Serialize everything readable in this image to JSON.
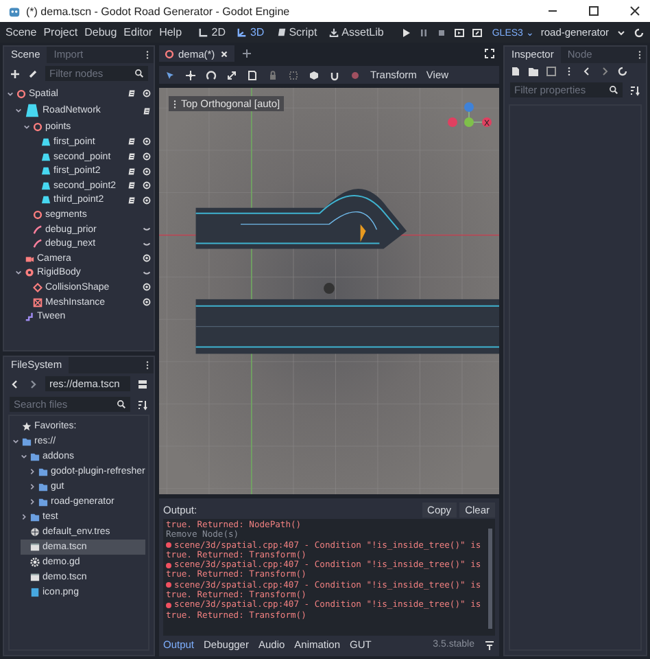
{
  "window": {
    "title": "(*) dema.tscn - Godot Road Generator - Godot Engine"
  },
  "menu": [
    "Scene",
    "Project",
    "Debug",
    "Editor",
    "Help"
  ],
  "workspaces": [
    {
      "label": "2D",
      "kind": "flat",
      "selected": false
    },
    {
      "label": "3D",
      "kind": "spatial",
      "selected": true
    },
    {
      "label": "Script",
      "kind": "script",
      "selected": false
    },
    {
      "label": "AssetLib",
      "kind": "assetlib",
      "selected": false
    }
  ],
  "renderer": "GLES3 ⌄",
  "project": "road-generator",
  "scene_dock": {
    "tabs": [
      {
        "label": "Scene",
        "selected": true
      },
      {
        "label": "Import",
        "selected": false
      }
    ],
    "filter": {
      "placeholder": "Filter nodes"
    },
    "tree": [
      {
        "name": "Spatial",
        "kind": "spatial",
        "script": true,
        "visible": true,
        "expanded": true,
        "children": [
          {
            "name": "RoadNetwork",
            "kind": "road",
            "script": true,
            "expanded": true,
            "children": [
              {
                "name": "points",
                "kind": "spatial",
                "expanded": true,
                "children": [
                  {
                    "name": "first_point",
                    "kind": "point",
                    "script": true,
                    "visible": true
                  },
                  {
                    "name": "second_point",
                    "kind": "point",
                    "script": true,
                    "visible": true
                  },
                  {
                    "name": "first_point2",
                    "kind": "point",
                    "script": true,
                    "visible": true
                  },
                  {
                    "name": "second_point2",
                    "kind": "point",
                    "script": true,
                    "visible": true
                  },
                  {
                    "name": "third_point2",
                    "kind": "point",
                    "script": true,
                    "visible": true
                  }
                ]
              },
              {
                "name": "segments",
                "kind": "spatial"
              },
              {
                "name": "debug_prior",
                "kind": "path",
                "visible": false
              },
              {
                "name": "debug_next",
                "kind": "path",
                "visible": false
              }
            ]
          },
          {
            "name": "Camera",
            "kind": "camera",
            "visible": true
          },
          {
            "name": "RigidBody",
            "kind": "body",
            "visible": false,
            "expanded": true,
            "children": [
              {
                "name": "CollisionShape",
                "kind": "collision",
                "visible": true
              },
              {
                "name": "MeshInstance",
                "kind": "mesh",
                "visible": true
              }
            ]
          },
          {
            "name": "Tween",
            "kind": "tween"
          }
        ]
      }
    ]
  },
  "filesystem": {
    "title": "FileSystem",
    "path": "res://dema.tscn",
    "search": {
      "placeholder": "Search files"
    },
    "tree": [
      {
        "name": "Favorites:",
        "kind": "favorites",
        "selected": false
      },
      {
        "name": "res://",
        "kind": "folder",
        "expanded": true,
        "selected": false,
        "children": [
          {
            "name": "addons",
            "kind": "folder",
            "expanded": true,
            "selected": false,
            "children": [
              {
                "name": "godot-plugin-refresher",
                "kind": "folder",
                "expanded": false,
                "selected": false
              },
              {
                "name": "gut",
                "kind": "folder",
                "expanded": false,
                "selected": false
              },
              {
                "name": "road-generator",
                "kind": "folder",
                "expanded": false,
                "selected": false
              }
            ]
          },
          {
            "name": "test",
            "kind": "folder",
            "expanded": false,
            "selected": false
          },
          {
            "name": "default_env.tres",
            "kind": "env",
            "selected": false
          },
          {
            "name": "dema.tscn",
            "kind": "scene",
            "selected": true
          },
          {
            "name": "demo.gd",
            "kind": "gd",
            "selected": false
          },
          {
            "name": "demo.tscn",
            "kind": "scene",
            "selected": false
          },
          {
            "name": "icon.png",
            "kind": "image",
            "selected": false
          }
        ]
      }
    ]
  },
  "editor_tabs": [
    {
      "label": "dema(*)",
      "selected": true
    }
  ],
  "toolbar": [
    "Transform",
    "View"
  ],
  "viewport": {
    "label": "Top Orthogonal [auto]",
    "gizmo_axis": "X"
  },
  "output": {
    "title": "Output:",
    "buttons": [
      "Copy",
      "Clear"
    ],
    "lines": [
      {
        "kind": "error",
        "text": "true. Returned: NodePath()"
      },
      {
        "kind": "info",
        "text": "Remove Node(s)"
      },
      {
        "kind": "error-head",
        "text": "scene/3d/spatial.cpp:407 - Condition \"!is_inside_tree()\" is"
      },
      {
        "kind": "error",
        "text": "true. Returned: Transform()"
      },
      {
        "kind": "error-head",
        "text": "scene/3d/spatial.cpp:407 - Condition \"!is_inside_tree()\" is"
      },
      {
        "kind": "error",
        "text": "true. Returned: Transform()"
      },
      {
        "kind": "error-head",
        "text": "scene/3d/spatial.cpp:407 - Condition \"!is_inside_tree()\" is"
      },
      {
        "kind": "error",
        "text": "true. Returned: Transform()"
      },
      {
        "kind": "error-head",
        "text": "scene/3d/spatial.cpp:407 - Condition \"!is_inside_tree()\" is"
      },
      {
        "kind": "error",
        "text": "true. Returned: Transform()"
      }
    ]
  },
  "bottom_tabs": [
    {
      "label": "Output",
      "selected": true
    },
    {
      "label": "Debugger",
      "selected": false
    },
    {
      "label": "Audio",
      "selected": false
    },
    {
      "label": "Animation",
      "selected": false
    },
    {
      "label": "GUT",
      "selected": false
    }
  ],
  "version": "3.5.stable",
  "inspector": {
    "tabs": [
      {
        "label": "Inspector",
        "selected": true
      },
      {
        "label": "Node",
        "selected": false
      }
    ],
    "filter": {
      "placeholder": "Filter properties"
    }
  }
}
